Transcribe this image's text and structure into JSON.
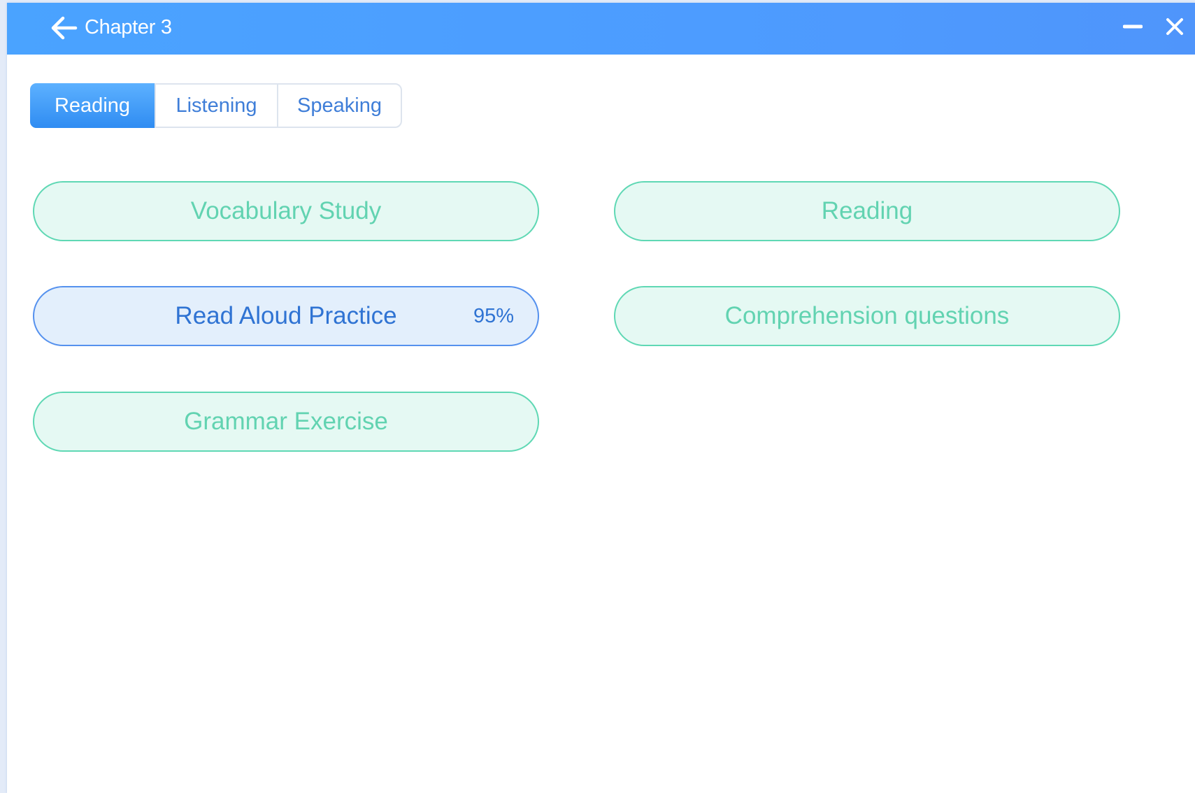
{
  "window": {
    "title": "Chapter 3"
  },
  "tabs": [
    {
      "label": "Reading",
      "active": true
    },
    {
      "label": "Listening",
      "active": false
    },
    {
      "label": "Speaking",
      "active": false
    }
  ],
  "activities": [
    {
      "label": "Vocabulary Study"
    },
    {
      "label": "Reading"
    },
    {
      "label": "Read Aloud Practice",
      "progress": "95%"
    },
    {
      "label": "Comprehension questions"
    },
    {
      "label": "Grammar Exercise"
    }
  ],
  "icons": {
    "back": "arrow-left-icon",
    "minimize": "minus-icon",
    "close": "close-icon"
  },
  "colors": {
    "titlebar": "#4d9cff",
    "tab_active": "#3d97f7",
    "tab_text": "#3f7ed8",
    "activity_border": "#5fd8b4",
    "activity_fill": "#e5f9f3",
    "activity_text": "#62d3b1",
    "highlight_border": "#5591ee",
    "highlight_fill": "#e3effc",
    "highlight_text": "#2f73d3"
  }
}
